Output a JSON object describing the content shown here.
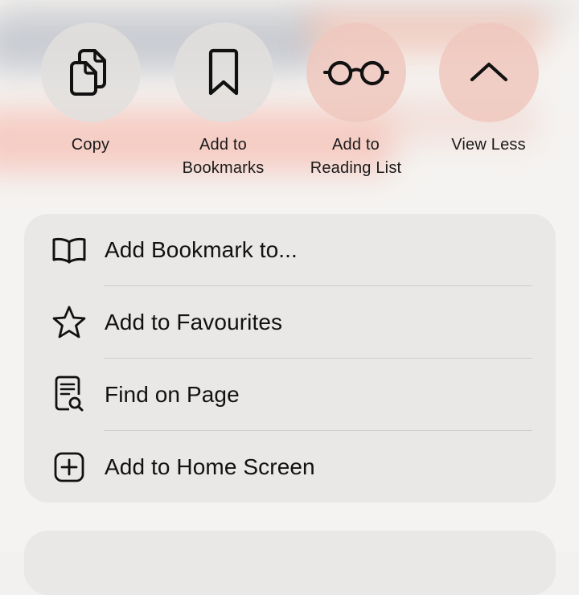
{
  "share_actions": [
    {
      "label": "Copy",
      "icon": "copy-icon"
    },
    {
      "label": "Add to\nBookmarks",
      "icon": "bookmark-icon"
    },
    {
      "label": "Add to\nReading List",
      "icon": "glasses-icon"
    },
    {
      "label": "View Less",
      "icon": "chevron-up-icon"
    }
  ],
  "menu": {
    "items": [
      {
        "label": "Add Bookmark to...",
        "icon": "book-icon"
      },
      {
        "label": "Add to Favourites",
        "icon": "star-icon"
      },
      {
        "label": "Find on Page",
        "icon": "find-document-icon"
      },
      {
        "label": "Add to Home Screen",
        "icon": "plus-square-icon"
      }
    ]
  }
}
